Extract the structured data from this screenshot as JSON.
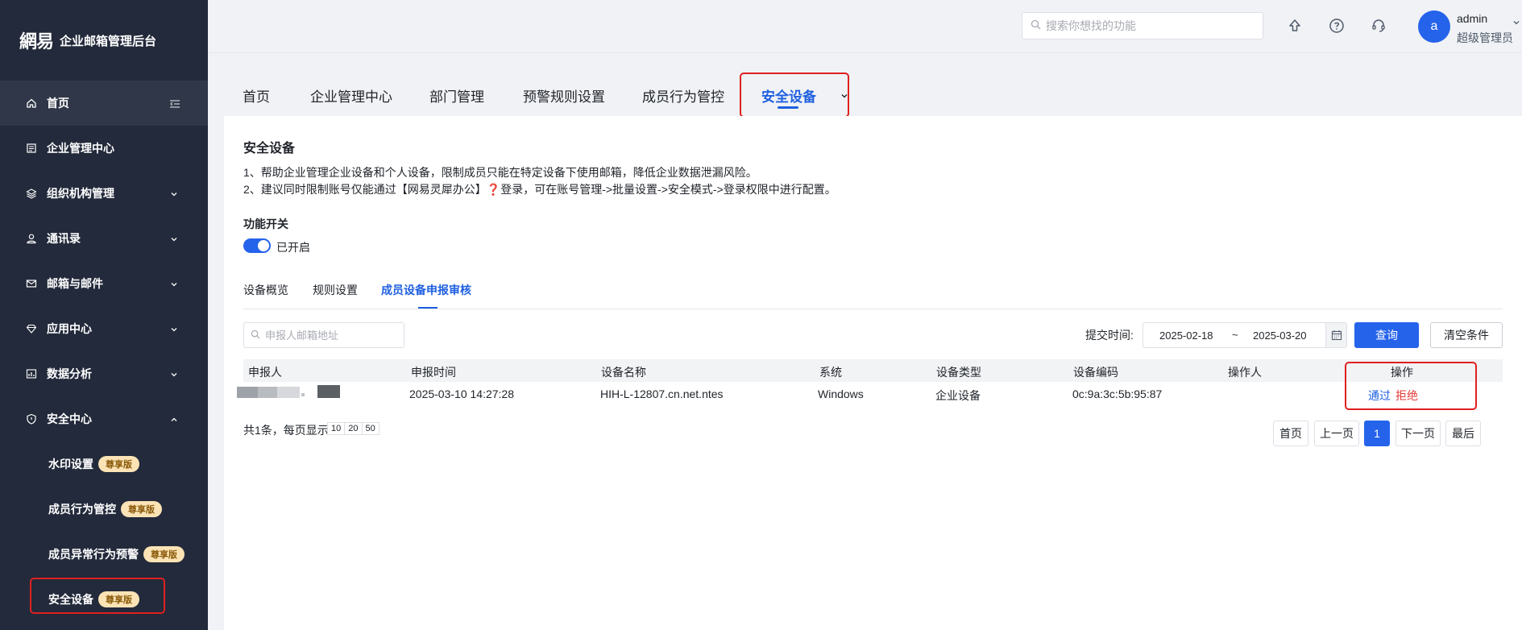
{
  "brand": {
    "mark": "網易",
    "title": "企业邮箱管理后台"
  },
  "sidebar": {
    "items": [
      {
        "label": "首页"
      },
      {
        "label": "企业管理中心"
      },
      {
        "label": "组织机构管理"
      },
      {
        "label": "通讯录"
      },
      {
        "label": "邮箱与邮件"
      },
      {
        "label": "应用中心"
      },
      {
        "label": "数据分析"
      },
      {
        "label": "安全中心"
      }
    ],
    "sub_items": [
      {
        "label": "水印设置",
        "badge": "尊享版"
      },
      {
        "label": "成员行为管控",
        "badge": "尊享版"
      },
      {
        "label": "成员异常行为预警",
        "badge": "尊享版"
      },
      {
        "label": "安全设备",
        "badge": "尊享版"
      }
    ]
  },
  "header": {
    "search_placeholder": "搜索你想找的功能",
    "avatar_letter": "a",
    "user_name": "admin",
    "user_role": "超级管理员"
  },
  "tabs": [
    {
      "label": "首页"
    },
    {
      "label": "企业管理中心"
    },
    {
      "label": "部门管理"
    },
    {
      "label": "预警规则设置"
    },
    {
      "label": "成员行为管控"
    },
    {
      "label": "安全设备"
    }
  ],
  "page": {
    "title": "安全设备",
    "desc1": "1、帮助企业管理企业设备和个人设备，限制成员只能在特定设备下使用邮箱，降低企业数据泄漏风险。",
    "desc2": "2、建议同时限制账号仅能通过【网易灵犀办公】❓登录，可在账号管理->批量设置->安全模式->登录权限中进行配置。",
    "switch_label": "功能开关",
    "switch_state": "已开启",
    "subtabs": [
      "设备概览",
      "规则设置",
      "成员设备申报审核"
    ]
  },
  "filter": {
    "email_placeholder": "申报人邮箱地址",
    "date_label": "提交时间:",
    "date_from": "2025-02-18",
    "date_sep": "~",
    "date_to": "2025-03-20",
    "query": "查询",
    "clear": "清空条件"
  },
  "table": {
    "headers": [
      "申报人",
      "申报时间",
      "设备名称",
      "系统",
      "设备类型",
      "设备编码",
      "操作人",
      "操作"
    ],
    "rows": [
      {
        "time": "2025-03-10 14:27:28",
        "device": "HIH-L-12807.cn.net.ntes",
        "os": "Windows",
        "type": "企业设备",
        "code": "0c:9a:3c:5b:95:87",
        "operator": "",
        "pass": "通过",
        "reject": "拒绝"
      }
    ]
  },
  "pagination": {
    "total": "共1条，每页显示",
    "sizes": [
      "10",
      "20",
      "50"
    ],
    "first": "首页",
    "prev": "上一页",
    "current": "1",
    "next": "下一页",
    "last": "最后"
  },
  "colors": {
    "sidebar": "#232a3b",
    "accent": "#2563eb",
    "danger": "#e53935",
    "highlight": "#e02020",
    "badge": "#fbe3b5"
  }
}
